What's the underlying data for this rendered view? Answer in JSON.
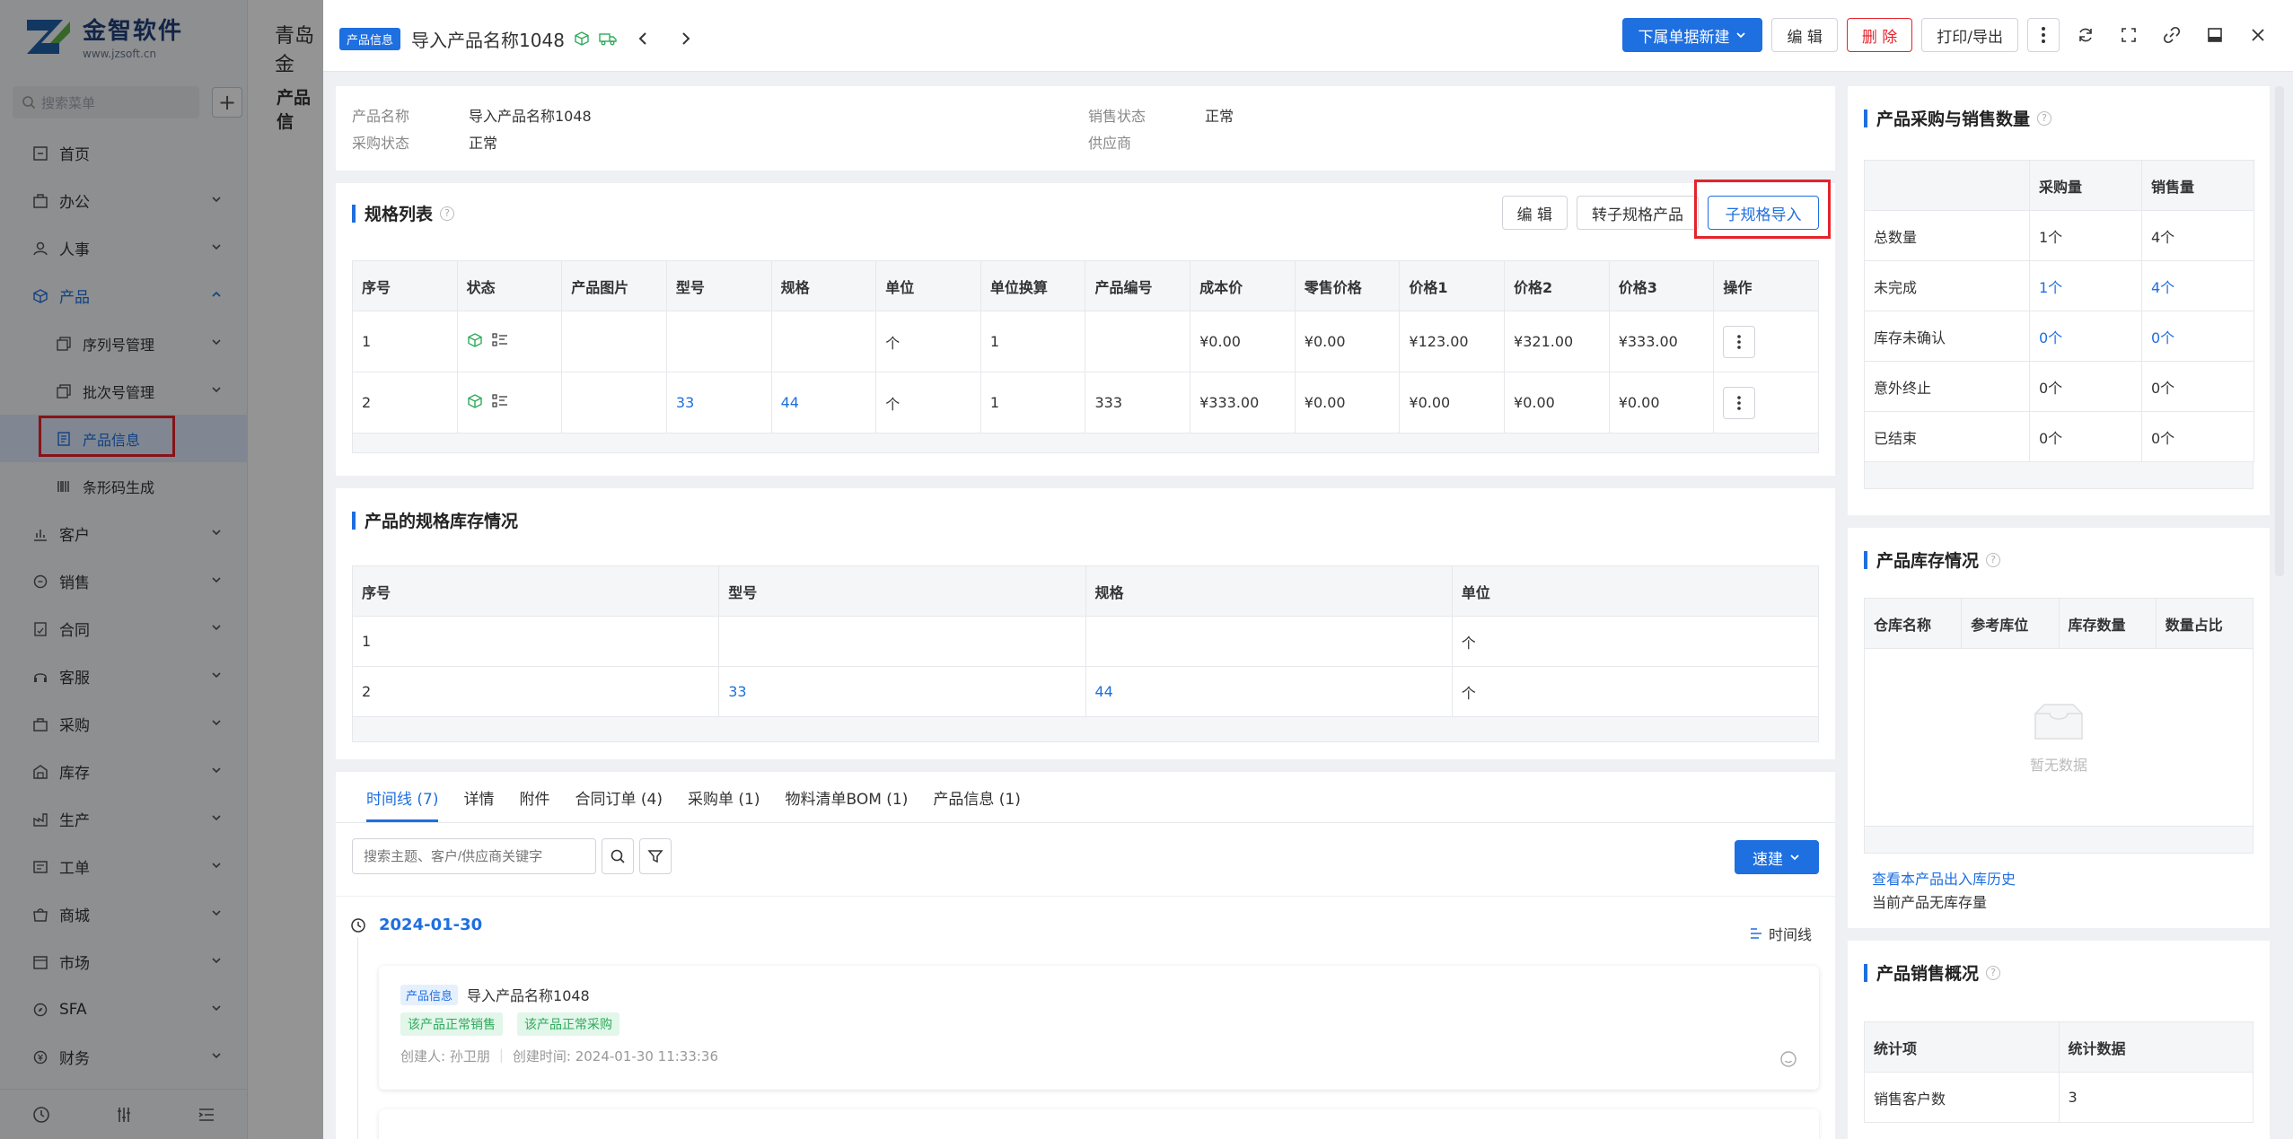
{
  "sidebar": {
    "logo_text": "金智软件",
    "logo_url_text": "www.jzsoft.cn",
    "search_placeholder": "搜索菜单",
    "items": [
      {
        "label": "首页"
      },
      {
        "label": "办公"
      },
      {
        "label": "人事"
      },
      {
        "label": "产品"
      },
      {
        "label": "序列号管理"
      },
      {
        "label": "批次号管理"
      },
      {
        "label": "产品信息"
      },
      {
        "label": "条形码生成"
      },
      {
        "label": "客户"
      },
      {
        "label": "销售"
      },
      {
        "label": "合同"
      },
      {
        "label": "客服"
      },
      {
        "label": "采购"
      },
      {
        "label": "库存"
      },
      {
        "label": "生产"
      },
      {
        "label": "工单"
      },
      {
        "label": "商城"
      },
      {
        "label": "市场"
      },
      {
        "label": "SFA"
      },
      {
        "label": "财务"
      }
    ]
  },
  "background_page": {
    "title": "青岛金",
    "subtitle": "产品信"
  },
  "drawer": {
    "tag": "产品信息",
    "title": "导入产品名称1048",
    "actions": {
      "new_dropdown": "下属单据新建",
      "edit": "编 辑",
      "delete": "删 除",
      "print": "打印/导出"
    },
    "info": {
      "product_name_label": "产品名称",
      "product_name_value": "导入产品名称1048",
      "purchase_status_label": "采购状态",
      "purchase_status_value": "正常",
      "sales_status_label": "销售状态",
      "sales_status_value": "正常",
      "supplier_label": "供应商",
      "supplier_value": ""
    },
    "spec_list": {
      "title": "规格列表",
      "buttons": {
        "edit": "编 辑",
        "to_spec": "转子规格产品",
        "import": "子规格导入"
      },
      "headers": [
        "序号",
        "状态",
        "产品图片",
        "型号",
        "规格",
        "单位",
        "单位换算",
        "产品编号",
        "成本价",
        "零售价格",
        "价格1",
        "价格2",
        "价格3",
        "操作"
      ],
      "rows": [
        [
          "1",
          "",
          "",
          "",
          "",
          "个",
          "1",
          "",
          "¥0.00",
          "¥0.00",
          "¥123.00",
          "¥321.00",
          "¥333.00"
        ],
        [
          "2",
          "",
          "",
          "33",
          "44",
          "个",
          "1",
          "333",
          "¥333.00",
          "¥0.00",
          "¥0.00",
          "¥0.00",
          "¥0.00"
        ]
      ]
    },
    "spec_stock": {
      "title": "产品的规格库存情况",
      "headers": [
        "序号",
        "型号",
        "规格",
        "单位"
      ],
      "rows": [
        [
          "1",
          "",
          "",
          "个"
        ],
        [
          "2",
          "33",
          "44",
          "个"
        ]
      ]
    },
    "tabs": [
      "时间线 (7)",
      "详情",
      "附件",
      "合同订单 (4)",
      "采购单 (1)",
      "物料清单BOM (1)",
      "产品信息 (1)"
    ],
    "timeline": {
      "search_placeholder": "搜索主题、客户/供应商关键字",
      "quick_button": "速建",
      "date": "2024-01-30",
      "mode_label": "时间线",
      "entry": {
        "tag": "产品信息",
        "title": "导入产品名称1048",
        "badges": [
          "该产品正常销售",
          "该产品正常采购"
        ],
        "creator": "创建人: 孙卫朋",
        "created_time": "创建时间: 2024-01-30 11:33:36"
      }
    }
  },
  "right": {
    "purchase_sales": {
      "title": "产品采购与销售数量",
      "headers": [
        "",
        "采购量",
        "销售量"
      ],
      "rows": [
        {
          "label": "总数量",
          "purchase": "1个",
          "sales": "4个",
          "link": false
        },
        {
          "label": "未完成",
          "purchase": "1个",
          "sales": "4个",
          "link": true
        },
        {
          "label": "库存未确认",
          "purchase": "0个",
          "sales": "0个",
          "link": true
        },
        {
          "label": "意外终止",
          "purchase": "0个",
          "sales": "0个",
          "link": false
        },
        {
          "label": "已结束",
          "purchase": "0个",
          "sales": "0个",
          "link": false
        }
      ]
    },
    "stock": {
      "title": "产品库存情况",
      "headers": [
        "仓库名称",
        "参考库位",
        "库存数量",
        "数量占比"
      ],
      "empty_text": "暂无数据",
      "history_link": "查看本产品出入库历史",
      "note": "当前产品无库存量"
    },
    "sales_overview": {
      "title": "产品销售概况",
      "headers": [
        "统计项",
        "统计数据"
      ],
      "rows": [
        [
          "销售客户数",
          "3"
        ]
      ]
    }
  },
  "colors": {
    "accent": "#1e6fe0",
    "danger": "#e5232b",
    "success": "#2eaa5a"
  }
}
